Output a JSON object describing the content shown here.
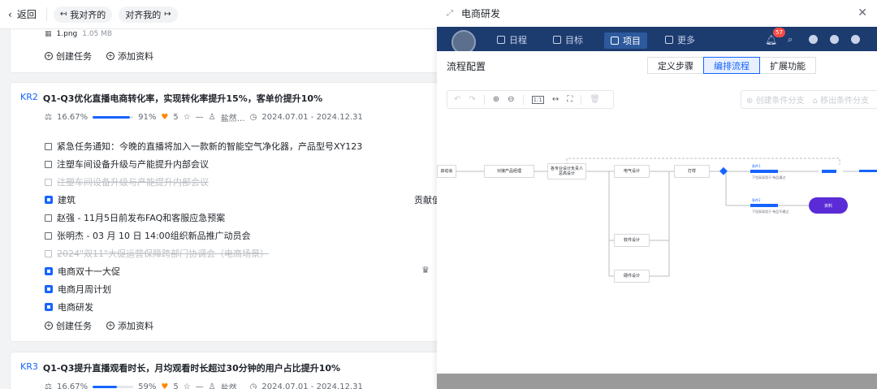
{
  "left": {
    "back_label": "返回",
    "pill_mine": "我对齐的",
    "pill_others": "对齐我的",
    "attachment": {
      "name": "1.png",
      "size": "1.05 MB"
    },
    "actions": {
      "create_task": "创建任务",
      "add_material": "添加资料"
    },
    "kr2": {
      "tag": "KR2",
      "title": "Q1-Q3优化直播电商转化率，实现转化率提升15%，客单价提升10%",
      "weight": "16.67%",
      "progress_label": "91%",
      "progress": 0.91,
      "likes": "5",
      "star_text": "—",
      "owner": "盐然…",
      "date_range": "2024.07.01 - 2024.12.31",
      "items": [
        {
          "type": "task",
          "done": false,
          "text": "紧急任务通知：今晚的直播将加入一款新的智能空气净化器，产品型号XY123"
        },
        {
          "type": "task",
          "done": false,
          "text": "注塑车间设备升级与产能提升内部会议"
        },
        {
          "type": "task",
          "done": true,
          "text": "注塑车间设备升级与产能提升内部会议"
        },
        {
          "type": "project",
          "text": "建筑",
          "extra": "贡献值"
        },
        {
          "type": "task",
          "done": false,
          "text": "赵强 - 11月5日前发布FAQ和客服应急预案"
        },
        {
          "type": "task",
          "done": false,
          "text": "张明杰 - 03 月 10 日 14:00组织新品推广动员会"
        },
        {
          "type": "task",
          "done": true,
          "text": "2024\"双11\"大促运营保障跨部门协调会（电商场景）"
        },
        {
          "type": "project",
          "text": "电商双十一大促"
        },
        {
          "type": "project",
          "text": "电商月周计划"
        },
        {
          "type": "project",
          "text": "电商研发"
        }
      ]
    },
    "kr3": {
      "tag": "KR3",
      "title": "Q1-Q3提升直播观看时长，月均观看时长超过30分钟的用户占比提升10%",
      "weight": "16.67%",
      "progress_label": "59%",
      "progress": 0.59,
      "likes": "5",
      "star_text": "—",
      "owner": "盐然…",
      "date_range": "2024.07.01 - 2024.12.31"
    }
  },
  "right": {
    "title": "电商研发",
    "nav": {
      "tabs": [
        "日程",
        "目标",
        "项目",
        "更多"
      ],
      "active": "项目",
      "badge": "57"
    },
    "section_title": "流程配置",
    "segments": [
      "定义步骤",
      "编排流程",
      "扩展功能"
    ],
    "active_segment": "编排流程",
    "toolbar": {
      "zoom_fit": "1:1"
    },
    "branch_tools": {
      "create": "创建条件分支",
      "remove": "移出条件分支"
    },
    "flow": {
      "nodes": [
        "启动会",
        "对接产品经理",
        "各专业设计负责人\n总高设计",
        "电气设计",
        "打样",
        "软件设计",
        "硬件设计"
      ],
      "branch1": {
        "label": "条件1",
        "desc": "下包采采用于·待品通过"
      },
      "branch2": {
        "label": "条件2",
        "desc": "下包采采用于·待品不通过"
      },
      "end_node": "资料"
    },
    "colors": {
      "accent": "#1664ff",
      "nav_bg": "#1c3b6e",
      "end_node": "#5a2bd6"
    }
  }
}
